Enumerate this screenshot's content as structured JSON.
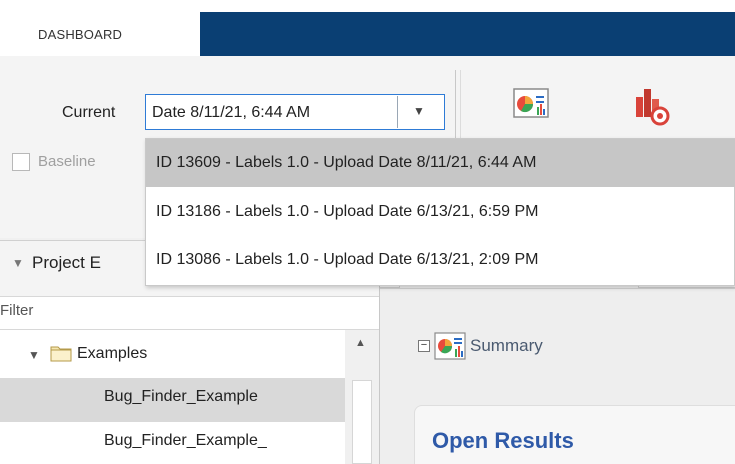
{
  "tabs": {
    "dashboard": "DASHBOARD"
  },
  "toolstrip": {
    "current_label": "Current",
    "current_value": "Date 8/11/21, 6:44 AM",
    "baseline_label": "Baseline",
    "baseline_checked": false
  },
  "dropdown": {
    "options": [
      "ID 13609 - Labels 1.0 - Upload Date 8/11/21, 6:44 AM",
      "ID 13186 - Labels 1.0 - Upload Date 6/13/21, 6:59 PM",
      "ID 13086 - Labels 1.0 - Upload Date 6/13/21, 2:09 PM"
    ],
    "selected_index": 0
  },
  "project_panel": {
    "title": "Project E",
    "filter_placeholder": "Filter",
    "folder": "Examples",
    "items": [
      "Bug_Finder_Example",
      "Bug_Finder_Example_"
    ]
  },
  "content": {
    "summary_label": "Summary",
    "open_results_label": "Open Results"
  },
  "icons": {
    "summary": "summary-chart-icon",
    "chart": "bar-chart-alert-icon",
    "folder": "folder-icon"
  },
  "colors": {
    "tabbar": "#0a3f73",
    "selection": "#c6c6c6",
    "focus": "#2e7bd6",
    "heading_link": "#2f5aa8"
  }
}
